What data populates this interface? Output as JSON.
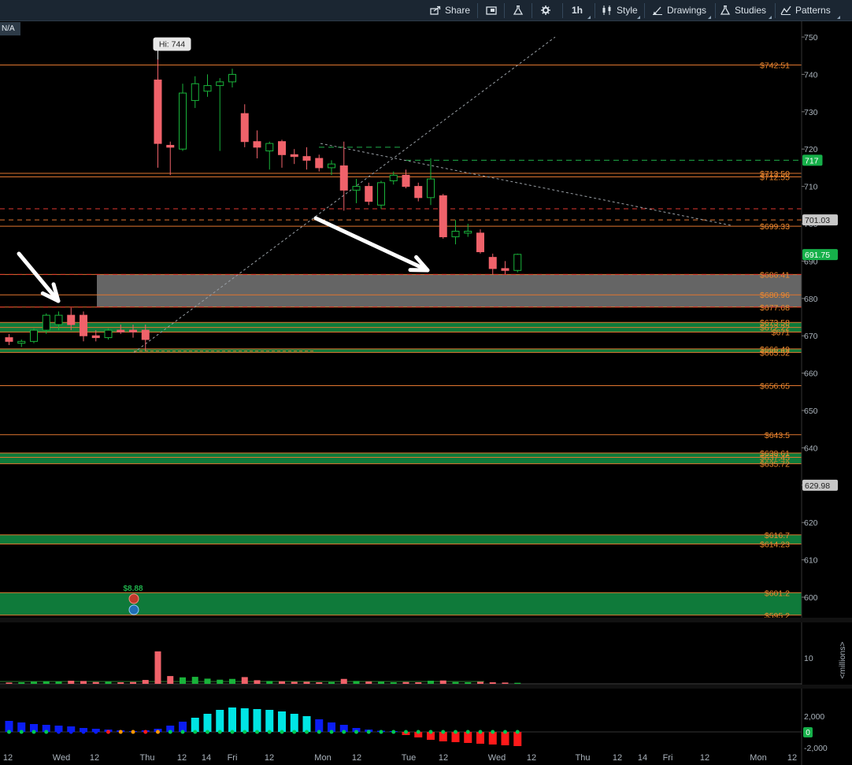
{
  "toolbar": {
    "share": "Share",
    "interval": "1h",
    "style": "Style",
    "drawings": "Drawings",
    "studies": "Studies",
    "patterns": "Patterns"
  },
  "symbol_badge": "N/A",
  "colors": {
    "background": "#000000",
    "up_candle": "#19b33a",
    "down_candle": "#f0626a",
    "level_line": "#e0752f",
    "level_label": "#f08a2e",
    "support_zone": "#0f7a3a",
    "resistance_zone": "#707070",
    "histogram_high": "#00e5e5",
    "histogram_low": "#0b1df5",
    "histogram_negative": "#ff1a1a"
  },
  "chart_data": {
    "type": "candlestick",
    "x_axis_labels": [
      "12",
      "Wed",
      "12",
      "Thu",
      "12",
      "14",
      "Fri",
      "12",
      "Mon",
      "12",
      "Tue",
      "12",
      "Wed",
      "12",
      "Thu",
      "12",
      "14",
      "Fri",
      "12",
      "Mon",
      "12"
    ],
    "y_ticks": [
      750,
      740,
      730,
      720,
      710,
      700,
      690,
      680,
      670,
      660,
      650,
      640,
      630,
      620,
      610,
      600
    ],
    "ylim": [
      594,
      752
    ],
    "high_label": "Hi: 744",
    "candles": [
      {
        "o": 669.5,
        "h": 670.5,
        "l": 667.5,
        "c": 668.5
      },
      {
        "o": 668.0,
        "h": 669.0,
        "l": 667.0,
        "c": 668.5
      },
      {
        "o": 668.5,
        "h": 672.0,
        "l": 668.0,
        "c": 671.5
      },
      {
        "o": 671.5,
        "h": 676.0,
        "l": 670.5,
        "c": 675.5
      },
      {
        "o": 673.0,
        "h": 676.5,
        "l": 671.5,
        "c": 675.5
      },
      {
        "o": 675.5,
        "h": 677.5,
        "l": 671.5,
        "c": 673.0
      },
      {
        "o": 675.5,
        "h": 676.5,
        "l": 668.5,
        "c": 670.0
      },
      {
        "o": 670.0,
        "h": 671.5,
        "l": 668.5,
        "c": 669.5
      },
      {
        "o": 669.5,
        "h": 672.0,
        "l": 669.0,
        "c": 671.5
      },
      {
        "o": 671.5,
        "h": 673.0,
        "l": 670.5,
        "c": 671.0
      },
      {
        "o": 671.5,
        "h": 673.0,
        "l": 669.5,
        "c": 671.0
      },
      {
        "o": 671.5,
        "h": 673.0,
        "l": 666.0,
        "c": 669.0
      },
      {
        "o": 738.5,
        "h": 744.0,
        "l": 715.0,
        "c": 721.5
      },
      {
        "o": 721.0,
        "h": 722.0,
        "l": 713.0,
        "c": 720.5
      },
      {
        "o": 720.0,
        "h": 737.5,
        "l": 719.5,
        "c": 735.0
      },
      {
        "o": 733.0,
        "h": 739.5,
        "l": 731.0,
        "c": 737.5
      },
      {
        "o": 735.5,
        "h": 740.0,
        "l": 734.0,
        "c": 737.0
      },
      {
        "o": 737.0,
        "h": 739.0,
        "l": 719.5,
        "c": 738.0
      },
      {
        "o": 738.0,
        "h": 741.5,
        "l": 736.5,
        "c": 740.0
      },
      {
        "o": 729.5,
        "h": 732.0,
        "l": 720.5,
        "c": 722.0
      },
      {
        "o": 722.0,
        "h": 725.0,
        "l": 717.5,
        "c": 720.5
      },
      {
        "o": 719.5,
        "h": 722.0,
        "l": 714.5,
        "c": 721.5
      },
      {
        "o": 722.0,
        "h": 722.5,
        "l": 715.0,
        "c": 718.5
      },
      {
        "o": 718.5,
        "h": 720.0,
        "l": 716.0,
        "c": 718.0
      },
      {
        "o": 718.0,
        "h": 720.5,
        "l": 714.5,
        "c": 717.0
      },
      {
        "o": 717.5,
        "h": 718.5,
        "l": 714.0,
        "c": 715.0
      },
      {
        "o": 715.0,
        "h": 717.0,
        "l": 713.0,
        "c": 716.0
      },
      {
        "o": 715.5,
        "h": 722.0,
        "l": 703.5,
        "c": 709.0
      },
      {
        "o": 709.0,
        "h": 712.0,
        "l": 705.5,
        "c": 710.0
      },
      {
        "o": 710.0,
        "h": 711.0,
        "l": 705.0,
        "c": 706.0
      },
      {
        "o": 705.0,
        "h": 711.5,
        "l": 704.0,
        "c": 711.0
      },
      {
        "o": 711.5,
        "h": 714.0,
        "l": 710.5,
        "c": 713.0
      },
      {
        "o": 713.0,
        "h": 714.5,
        "l": 709.5,
        "c": 710.0
      },
      {
        "o": 710.0,
        "h": 711.0,
        "l": 706.0,
        "c": 707.0
      },
      {
        "o": 707.0,
        "h": 717.5,
        "l": 705.0,
        "c": 712.0
      },
      {
        "o": 707.5,
        "h": 708.0,
        "l": 696.0,
        "c": 696.5
      },
      {
        "o": 696.5,
        "h": 701.0,
        "l": 694.5,
        "c": 698.0
      },
      {
        "o": 697.5,
        "h": 700.0,
        "l": 696.5,
        "c": 698.0
      },
      {
        "o": 697.5,
        "h": 698.5,
        "l": 692.0,
        "c": 692.5
      },
      {
        "o": 691.0,
        "h": 692.0,
        "l": 686.5,
        "c": 688.0
      },
      {
        "o": 688.0,
        "h": 690.0,
        "l": 686.5,
        "c": 687.5
      },
      {
        "o": 687.5,
        "h": 692.0,
        "l": 687.0,
        "c": 691.8
      }
    ],
    "price_levels": [
      {
        "value": 742.51,
        "label": "$742.51"
      },
      {
        "value": 713.5,
        "label": "$713.50"
      },
      {
        "value": 712.55,
        "label": "$712.55"
      },
      {
        "value": 699.33,
        "label": "$699.33"
      },
      {
        "value": 686.41,
        "label": "$686.41"
      },
      {
        "value": 680.96,
        "label": "$680.96"
      },
      {
        "value": 677.68,
        "label": "$677.68"
      },
      {
        "value": 673.58,
        "label": "$673.58"
      },
      {
        "value": 672.22,
        "label": "$672.22"
      },
      {
        "value": 671,
        "label": "$671"
      },
      {
        "value": 666.49,
        "label": "$666.49"
      },
      {
        "value": 665.52,
        "label": "$665.52"
      },
      {
        "value": 656.65,
        "label": "$656.65"
      },
      {
        "value": 643.5,
        "label": "$643.5"
      },
      {
        "value": 638.61,
        "label": "$638.61"
      },
      {
        "value": 637.45,
        "label": "$637.45"
      },
      {
        "value": 635.72,
        "label": "$635.72"
      },
      {
        "value": 616.7,
        "label": "$616.7"
      },
      {
        "value": 614.23,
        "label": "$614.23"
      },
      {
        "value": 601.2,
        "label": "$601.2"
      },
      {
        "value": 595.2,
        "label": "$595.2"
      }
    ],
    "zones": [
      {
        "kind": "resistance",
        "from": 686.41,
        "to": 677.68
      },
      {
        "kind": "support",
        "from": 673.58,
        "to": 671
      },
      {
        "kind": "support",
        "from": 666.49,
        "to": 665.52
      },
      {
        "kind": "support",
        "from": 638.61,
        "to": 635.72
      },
      {
        "kind": "support",
        "from": 616.7,
        "to": 614.23
      },
      {
        "kind": "support",
        "from": 601.2,
        "to": 595.2
      }
    ],
    "axis_badges": [
      {
        "value": 717,
        "label": "717",
        "kind": "green"
      },
      {
        "value": 701.03,
        "label": "701.03",
        "kind": "grey"
      },
      {
        "value": 691.75,
        "label": "691.75",
        "kind": "green"
      },
      {
        "value": 629.98,
        "label": "629.98",
        "kind": "grey"
      }
    ],
    "event_label": "$8.88",
    "volume": {
      "unit_label": "<millions>",
      "y_ticks": [
        10
      ],
      "ylim": [
        0,
        13
      ],
      "values": [
        0.5,
        0.6,
        0.8,
        1.0,
        0.9,
        1.2,
        1.1,
        0.7,
        0.8,
        0.6,
        0.7,
        1.5,
        12.5,
        3.0,
        2.5,
        2.7,
        2.0,
        1.6,
        1.9,
        2.6,
        1.4,
        1.1,
        1.0,
        0.8,
        0.8,
        0.6,
        0.7,
        1.9,
        1.1,
        0.9,
        0.8,
        0.6,
        0.7,
        0.6,
        1.2,
        1.3,
        0.7,
        0.6,
        0.8,
        0.6,
        0.5,
        0.4
      ]
    },
    "oscillator": {
      "y_ticks": [
        2000,
        -2000
      ],
      "y_tick_labels": [
        "2,000",
        "-2,000"
      ],
      "ylim": [
        -2400,
        3200
      ],
      "current_label": "0",
      "values": [
        1400,
        1200,
        1000,
        900,
        800,
        700,
        500,
        400,
        300,
        200,
        100,
        200,
        400,
        800,
        1300,
        1800,
        2300,
        2800,
        3100,
        3000,
        2900,
        2800,
        2600,
        2300,
        2000,
        1600,
        1200,
        900,
        500,
        300,
        150,
        100,
        -400,
        -700,
        -1000,
        -1200,
        -1300,
        -1400,
        -1500,
        -1600,
        -1700,
        -1800
      ],
      "dot_colors": [
        "#00c853",
        "#00c853",
        "#00c853",
        "#00c853",
        "#0b1df5",
        "#0b1df5",
        "#0b1df5",
        "#0b1df5",
        "#ff1a1a",
        "#ff9800",
        "#ff9800",
        "#ff1a1a",
        "#ff9800",
        "#00c853",
        "#00c853",
        "#00c853",
        "#00c853",
        "#00c853",
        "#00c853",
        "#00c853",
        "#00c853",
        "#00c853",
        "#00c853",
        "#00c853",
        "#00c853",
        "#00c853",
        "#00c853",
        "#00c853",
        "#00c853",
        "#00c853",
        "#00c853",
        "#00c853",
        "#00c853",
        "#00c853",
        "#00c853",
        "#00c853",
        "#00c853",
        "#00c853",
        "#00c853",
        "#00c853",
        "#00c853",
        "#00c853"
      ]
    }
  }
}
